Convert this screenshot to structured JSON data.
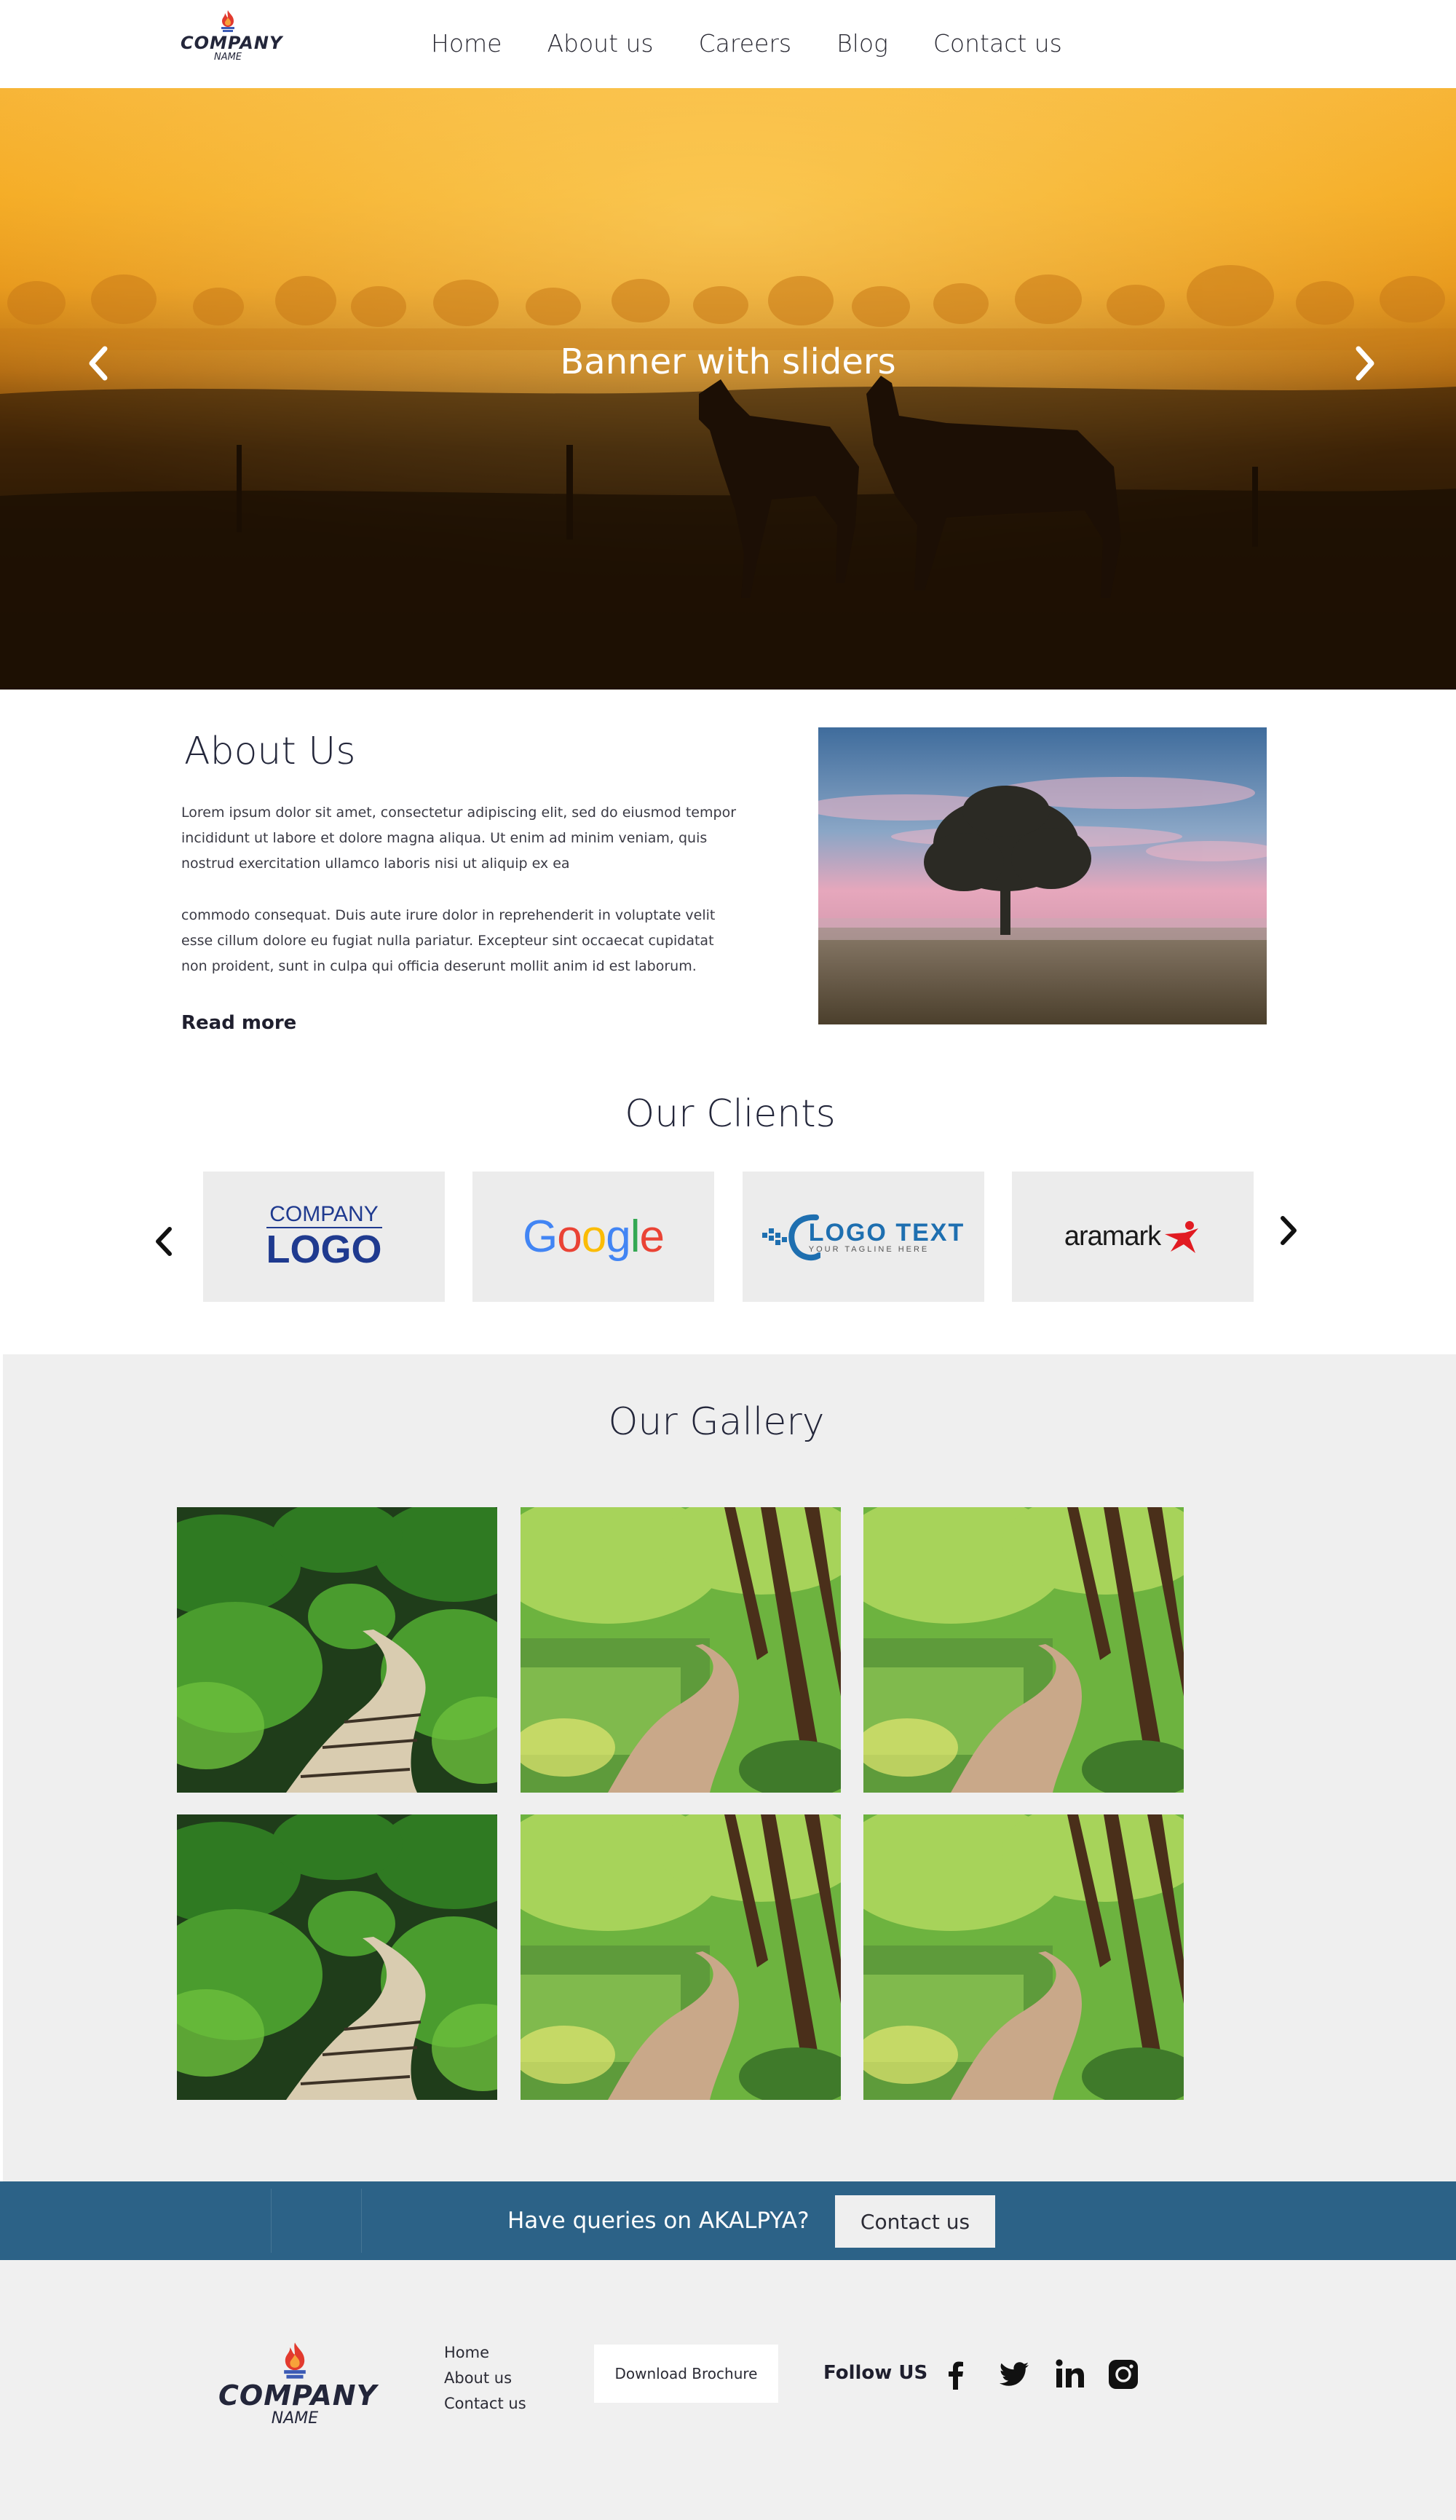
{
  "header": {
    "logo": {
      "line1": "COMPANY",
      "line2": "NAME"
    },
    "nav": [
      "Home",
      "About us",
      "Careers",
      "Blog",
      "Contact us"
    ]
  },
  "banner": {
    "title": "Banner with sliders"
  },
  "about": {
    "title": "About Us",
    "paragraph1": "Lorem ipsum dolor sit amet, consectetur adipiscing elit, sed do eiusmod tempor incididunt ut labore et dolore magna aliqua. Ut enim ad minim veniam, quis nostrud exercitation ullamco laboris nisi ut aliquip ex ea",
    "paragraph2": "commodo consequat. Duis aute irure dolor in reprehenderit in voluptate velit esse cillum dolore eu fugiat nulla pariatur. Excepteur sint occaecat cupidatat non proident, sunt in culpa qui officia deserunt mollit anim id est laborum.",
    "read_more": "Read more"
  },
  "clients": {
    "title": "Our Clients",
    "logos": {
      "company_logo": {
        "top": "COMPANY",
        "bottom": "LOGO"
      },
      "google": "Google",
      "logo_text": {
        "main": "LOGO TEXT",
        "tagline": "YOUR TAGLINE HERE"
      },
      "aramark": "aramark"
    }
  },
  "gallery": {
    "title": "Our Gallery"
  },
  "cta": {
    "text": "Have queries on AKALPYA?",
    "button": "Contact us"
  },
  "footer": {
    "logo": {
      "line1": "COMPANY",
      "line2": "NAME"
    },
    "links": [
      "Home",
      "About us",
      "Contact us"
    ],
    "brochure_button": "Download Brochure",
    "follow_label": "Follow US",
    "social_icons": [
      "facebook-icon",
      "twitter-icon",
      "linkedin-icon",
      "instagram-icon"
    ]
  },
  "colors": {
    "cta_band": "#2c6287",
    "gallery_bg": "#efefef",
    "footer_bg": "#f0f0f0",
    "client_tile": "#ececec",
    "text_dark": "#23263a"
  }
}
